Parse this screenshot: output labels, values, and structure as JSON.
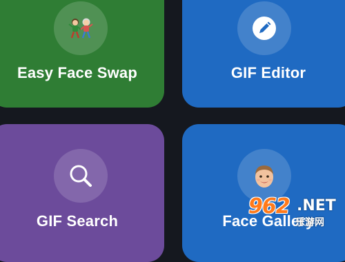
{
  "tiles": {
    "easy_face_swap": {
      "label": "Easy Face Swap",
      "color": "#2f7d34",
      "icon": "two-kids-icon"
    },
    "gif_editor": {
      "label": "GIF Editor",
      "color": "#1f6ac2",
      "icon": "pencil-icon"
    },
    "gif_search": {
      "label": "GIF Search",
      "color": "#6c4b9b",
      "icon": "search-icon"
    },
    "face_gallery": {
      "label": "Face Gallery",
      "color": "#1f6ac2",
      "icon": "child-face-icon"
    }
  },
  "watermark": {
    "number": "962",
    "domain": ".NET",
    "site_name": "乐游网"
  },
  "background_color": "#15181f"
}
